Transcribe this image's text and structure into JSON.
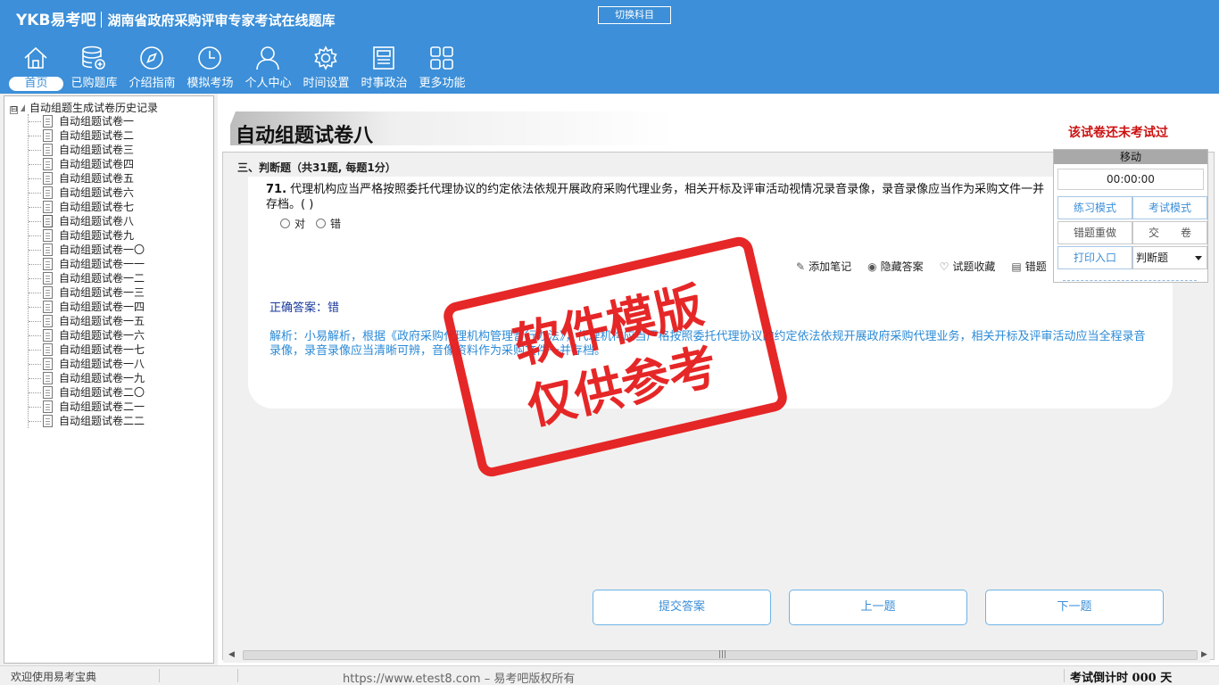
{
  "app": {
    "brand": "YKB易考吧",
    "subtitle": "湖南省政府采购评审专家考试在线题库",
    "switch_subject": "切换科目"
  },
  "nav": [
    {
      "label": "首页",
      "icon": "home-icon",
      "active": true
    },
    {
      "label": "已购题库",
      "icon": "database-icon"
    },
    {
      "label": "介绍指南",
      "icon": "compass-icon"
    },
    {
      "label": "模拟考场",
      "icon": "clock-icon"
    },
    {
      "label": "个人中心",
      "icon": "user-icon"
    },
    {
      "label": "时间设置",
      "icon": "gear-icon"
    },
    {
      "label": "时事政治",
      "icon": "news-icon"
    },
    {
      "label": "更多功能",
      "icon": "grid-icon"
    }
  ],
  "tree": {
    "root": "自动组题生成试卷历史记录",
    "toggle": "⊟",
    "items": [
      "自动组题试卷一",
      "自动组题试卷二",
      "自动组题试卷三",
      "自动组题试卷四",
      "自动组题试卷五",
      "自动组题试卷六",
      "自动组题试卷七",
      "自动组题试卷八",
      "自动组题试卷九",
      "自动组题试卷一〇",
      "自动组题试卷一一",
      "自动组题试卷一二",
      "自动组题试卷一三",
      "自动组题试卷一四",
      "自动组题试卷一五",
      "自动组题试卷一六",
      "自动组题试卷一七",
      "自动组题试卷一八",
      "自动组题试卷一九",
      "自动组题试卷二〇",
      "自动组题试卷二一",
      "自动组题试卷二二"
    ],
    "selected_index": 7
  },
  "paper": {
    "title": "自动组题试卷八",
    "status": "该试卷还未考试过",
    "section": "三、判断题（共31题, 每题1分）"
  },
  "question": {
    "number": "71.",
    "text": "代理机构应当严格按照委托代理协议的约定依法依规开展政府采购代理业务，相关开标及评审活动视情况录音录像，录音录像应当作为采购文件一并存档。( )",
    "options": [
      "对",
      "错"
    ],
    "tools": [
      {
        "label": "添加笔记",
        "icon": "pencil-icon",
        "glyph": "✎"
      },
      {
        "label": "隐藏答案",
        "icon": "eye-icon",
        "glyph": "◉"
      },
      {
        "label": "试题收藏",
        "icon": "heart-icon",
        "glyph": "♡"
      },
      {
        "label": "错题",
        "icon": "book-icon",
        "glyph": "▤"
      }
    ],
    "correct_answer": "正确答案：错",
    "analysis": "解析：小易解析，根据《政府采购代理机构管理暂行办法》，代理机构应当严格按照委托代理协议的约定依法依规开展政府采购代理业务，相关开标及评审活动应当全程录音录像，录音录像应当清晰可辨，音像资料作为采购文件一并存档。"
  },
  "stamp": [
    "软件模版",
    "仅供参考"
  ],
  "buttons": {
    "submit": "提交答案",
    "prev": "上一题",
    "next": "下一题"
  },
  "timer_panel": {
    "move": "移动",
    "clock": "00:00:00",
    "practice": "练习模式",
    "exam": "考试模式",
    "redo_wrong": "错题重做",
    "hand_in": "交　　卷",
    "print": "打印入口",
    "type_select": "判断题"
  },
  "statusbar": {
    "welcome": "欢迎使用易考宝典",
    "copyright": "https://www.etest8.com – 易考吧版权所有",
    "countdown": "考试倒计时 000 天"
  },
  "colors": {
    "header_blue": "#3c8fd8",
    "stamp_red": "#e51c1c",
    "status_red": "#cc1111",
    "answer_blue": "#1a3a9b",
    "analysis_blue": "#2b8ad6"
  }
}
